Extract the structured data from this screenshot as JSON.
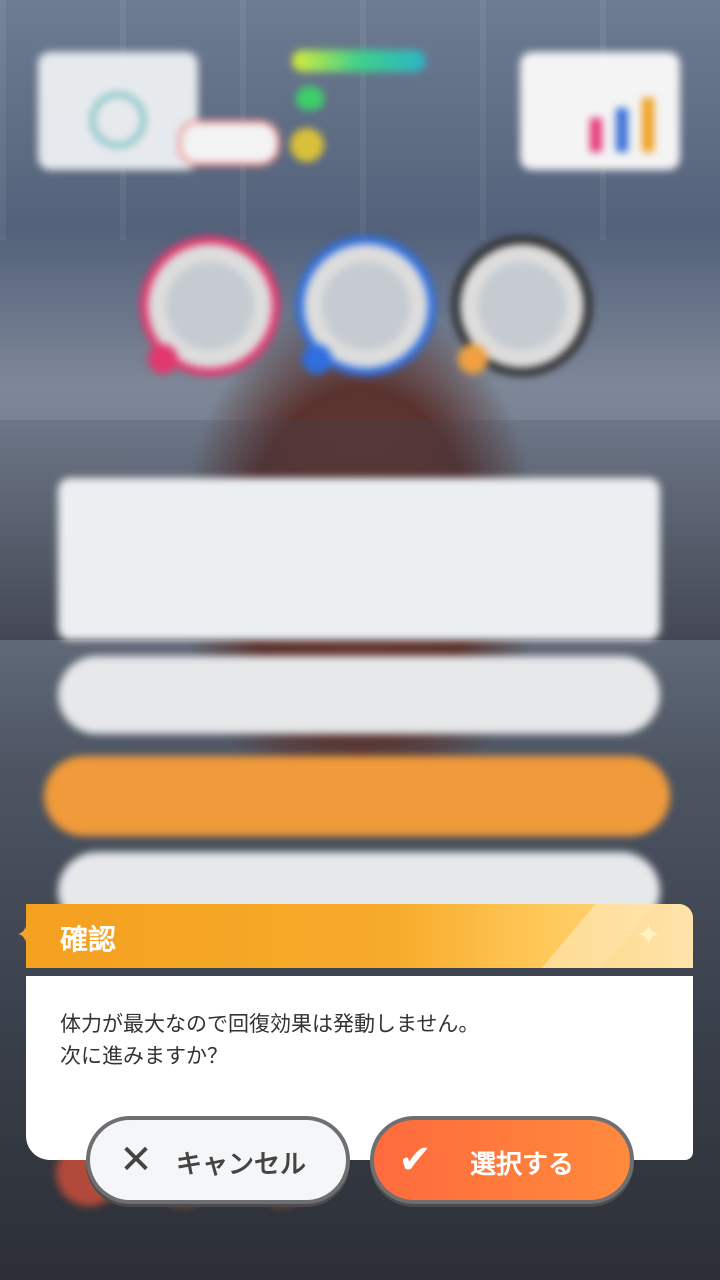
{
  "dialog": {
    "title": "確認",
    "message_line1": "体力が最大なので回復効果は発動しません。",
    "message_line2": "次に進みますか？",
    "cancel_label": "キャンセル",
    "confirm_label": "選択する"
  },
  "icons": {
    "header_left": "star-icon",
    "header_right": "sparkle-icon",
    "cancel": "close-icon",
    "confirm": "check-icon"
  },
  "colors": {
    "header": "#f4a020",
    "confirm_button": "#ff6a3d",
    "cancel_button": "#f5f6f7"
  }
}
